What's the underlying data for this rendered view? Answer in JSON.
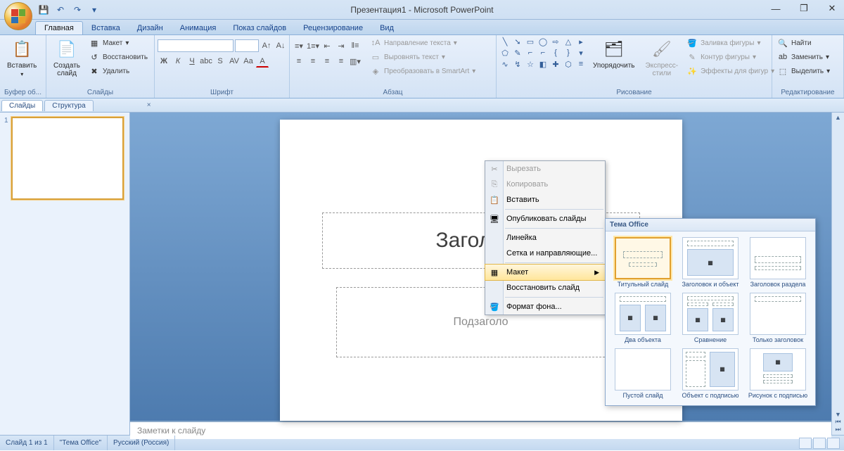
{
  "title": "Презентация1 - Microsoft PowerPoint",
  "tabs": [
    "Главная",
    "Вставка",
    "Дизайн",
    "Анимация",
    "Показ слайдов",
    "Рецензирование",
    "Вид"
  ],
  "ribbon": {
    "clipboard": {
      "paste": "Вставить",
      "label": "Буфер об..."
    },
    "slides": {
      "new": "Создать\nслайд",
      "layout": "Макет",
      "reset": "Восстановить",
      "delete": "Удалить",
      "label": "Слайды"
    },
    "font": {
      "label": "Шрифт"
    },
    "paragraph": {
      "dir": "Направление текста",
      "align": "Выровнять текст",
      "smartart": "Преобразовать в SmartArt",
      "label": "Абзац"
    },
    "drawing": {
      "arrange": "Упорядочить",
      "styles": "Экспресс-стили",
      "fill": "Заливка фигуры",
      "outline": "Контур фигуры",
      "effects": "Эффекты для фигур",
      "label": "Рисование"
    },
    "editing": {
      "find": "Найти",
      "replace": "Заменить",
      "select": "Выделить",
      "label": "Редактирование"
    }
  },
  "panels": {
    "slides": "Слайды",
    "outline": "Структура"
  },
  "slide": {
    "title": "Заголово",
    "subtitle": "Подзаголо"
  },
  "notes": "Заметки к слайду",
  "status": {
    "slide": "Слайд 1 из 1",
    "theme": "\"Тема Office\"",
    "lang": "Русский (Россия)"
  },
  "context": {
    "cut": "Вырезать",
    "copy": "Копировать",
    "paste": "Вставить",
    "publish": "Опубликовать слайды",
    "ruler": "Линейка",
    "grid": "Сетка и направляющие...",
    "layout": "Макет",
    "reset": "Восстановить слайд",
    "format": "Формат фона..."
  },
  "layout_flyout": {
    "header": "Тема Office",
    "items": [
      "Титульный слайд",
      "Заголовок и объект",
      "Заголовок раздела",
      "Два объекта",
      "Сравнение",
      "Только заголовок",
      "Пустой слайд",
      "Объект с подписью",
      "Рисунок с подписью"
    ]
  }
}
